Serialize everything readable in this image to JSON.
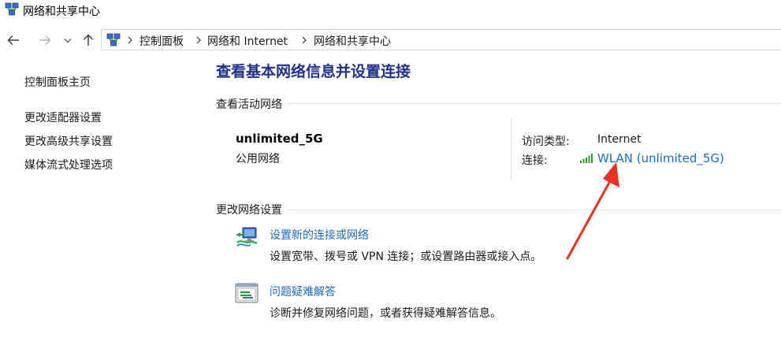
{
  "window": {
    "title": "网络和共享中心",
    "icon": "network-center-icon"
  },
  "nav": {
    "back_icon": "arrow-left-icon",
    "forward_icon": "arrow-right-icon",
    "recent_icon": "chevron-down-icon",
    "up_icon": "arrow-up-icon"
  },
  "breadcrumb": {
    "items": [
      "控制面板",
      "网络和 Internet",
      "网络和共享中心"
    ]
  },
  "sidebar": {
    "items": [
      {
        "label": "控制面板主页"
      },
      {
        "label": "更改适配器设置"
      },
      {
        "label": "更改高级共享设置"
      },
      {
        "label": "媒体流式处理选项"
      }
    ]
  },
  "main": {
    "heading": "查看基本网络信息并设置连接",
    "active_networks_title": "查看活动网络",
    "network": {
      "name": "unlimited_5G",
      "type": "公用网络",
      "access_label": "访问类型:",
      "access_value": "Internet",
      "connection_label": "连接:",
      "connection_value": "WLAN (unlimited_5G)",
      "signal_icon": "wifi-signal-icon"
    },
    "change_settings_title": "更改网络设置",
    "tasks": [
      {
        "title": "设置新的连接或网络",
        "desc": "设置宽带、拨号或 VPN 连接；或设置路由器或接入点。",
        "icon": "new-connection-icon"
      },
      {
        "title": "问题疑难解答",
        "desc": "诊断并修复网络问题，或者获得疑难解答信息。",
        "icon": "troubleshoot-icon"
      }
    ]
  },
  "colors": {
    "heading": "#1e3287",
    "link": "#1c6ac4",
    "annotation_arrow": "#e8321f"
  }
}
